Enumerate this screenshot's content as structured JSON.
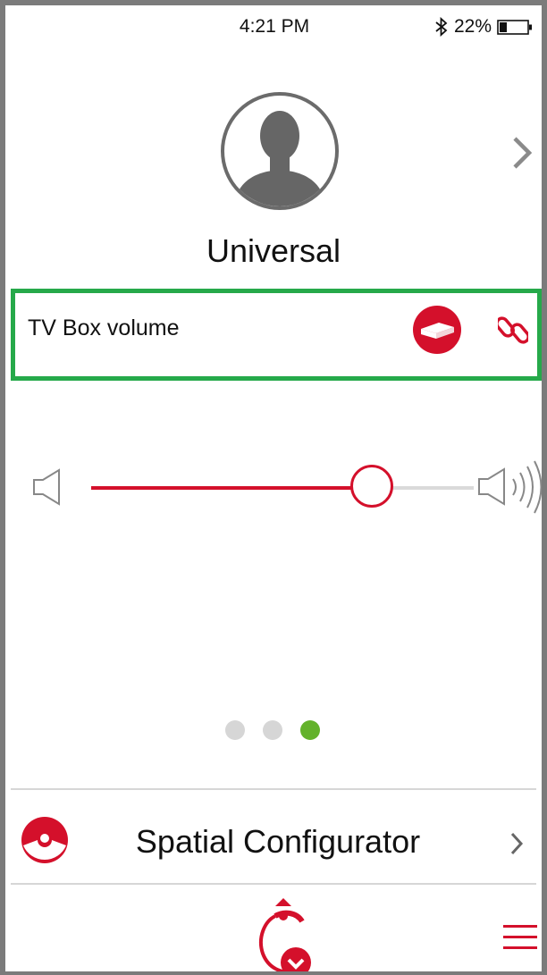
{
  "status_bar": {
    "time": "4:21 PM",
    "battery": "22%",
    "bluetooth_icon": "bluetooth-icon",
    "battery_icon": "battery-icon"
  },
  "profile": {
    "name": "Universal",
    "avatar_icon": "avatar-silhouette-icon",
    "next_icon": "chevron-right-icon"
  },
  "volume_control": {
    "label": "TV Box volume",
    "source_icon": "tv-box-icon",
    "link_icon": "link-icon",
    "slider_level_percent": 74
  },
  "pager": {
    "total": 3,
    "active_index": 2
  },
  "spatial_configurator": {
    "label": "Spatial Configurator",
    "icon": "spatial-configurator-icon",
    "chevron_icon": "chevron-right-icon"
  },
  "bottom_bar": {
    "logo_icon": "app-logo-icon",
    "menu_icon": "hamburger-menu-icon"
  },
  "colors": {
    "accent": "#d4102b",
    "highlight": "#26a94a",
    "pager_active": "#63b22b",
    "pager_inactive": "#d6d6d6"
  }
}
